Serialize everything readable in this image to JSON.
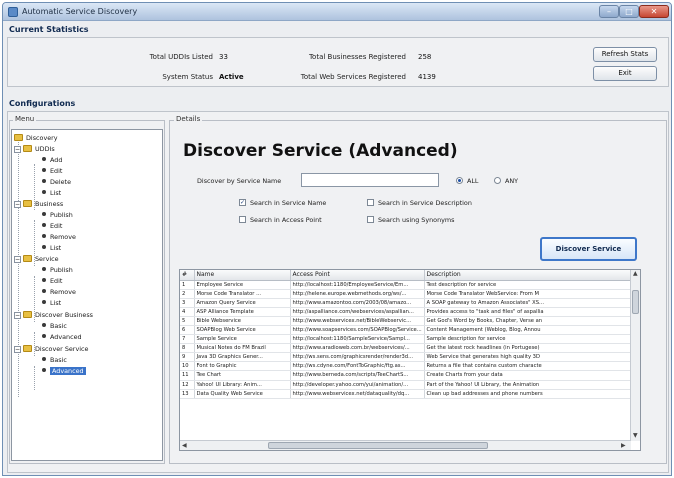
{
  "window": {
    "title": "Automatic Service Discovery",
    "min": "–",
    "max": "□",
    "close": "✕"
  },
  "stats": {
    "title": "Current Statistics",
    "total_uddis_label": "Total UDDIs Listed",
    "total_uddis_value": "33",
    "system_status_label": "System Status",
    "system_status_value": "Active",
    "businesses_label": "Total Businesses Registered",
    "businesses_value": "258",
    "web_services_label": "Total Web Services Registered",
    "web_services_value": "4139",
    "refresh_button": "Refresh Stats",
    "exit_button": "Exit"
  },
  "config": {
    "title": "Configurations",
    "menu_label": "Menu",
    "details_label": "Details"
  },
  "tree": {
    "root": "Discovery",
    "uddis": "UDDIs",
    "uddis_items": [
      "Add",
      "Edit",
      "Delete",
      "List"
    ],
    "business": "Business",
    "business_items": [
      "Publish",
      "Edit",
      "Remove",
      "List"
    ],
    "service": "Service",
    "service_items": [
      "Publish",
      "Edit",
      "Remove",
      "List"
    ],
    "discover_business": "Discover Business",
    "discover_business_items": [
      "Basic",
      "Advanced"
    ],
    "discover_service": "Discover Service",
    "discover_service_items": [
      "Basic",
      "Advanced"
    ]
  },
  "details": {
    "heading": "Discover Service (Advanced)",
    "search_label": "Discover by Service Name",
    "search_value": "",
    "radio_all": "ALL",
    "radio_any": "ANY",
    "radio_selected": "ALL",
    "check_service_name": "Search in Service Name",
    "check_service_description": "Search in Service Description",
    "check_access_point": "Search in Access Point",
    "check_synonyms": "Search using Synonyms",
    "discover_button": "Discover Service"
  },
  "table": {
    "headers": [
      "#",
      "Name",
      "Access Point",
      "Description"
    ],
    "rows": [
      [
        "1",
        "Employee Service",
        "http://localhost:1180/EmployeeService/Em...",
        "Test description for service"
      ],
      [
        "2",
        "Morse Code Translator ...",
        "http://helene.europe.webmethods.org/ws/...",
        "Morse Code Translator WebService: From M"
      ],
      [
        "3",
        "Amazon Query Service",
        "http://www.amazontoo.com/2003/08/amazo...",
        "A SOAP gateway to Amazon Associates\" XS..."
      ],
      [
        "4",
        "ASP Alliance Template",
        "http://aspalliance.com/webservices/aspallian...",
        "Provides access to \"task and files\" of aspallia"
      ],
      [
        "5",
        "Bible Webservice",
        "http://www.webservicex.net/BibleWebservic...",
        "Get God's Word by Books, Chapter, Verse an"
      ],
      [
        "6",
        "SOAPBlog Web Service",
        "http://www.soapservices.com/SOAPBlog/Service...",
        "Content Management (Weblog, Blog, Annou"
      ],
      [
        "7",
        "Sample Service",
        "http://localhost:1180/SampleService/Sampl...",
        "Sample description for service"
      ],
      [
        "8",
        "Musical Notes do FM Brazil",
        "http://www.aradioweb.com.br/webservices/...",
        "Get the latest rock headlines (in Portugese)"
      ],
      [
        "9",
        "Java 3D Graphics Gener...",
        "http://ws.sens.com/graphicsrender/render3d...",
        "Web Service that generates high quality 3D"
      ],
      [
        "10",
        "Font to Graphic",
        "http://ws.cdyne.com/FontToGraphic/ftg.as...",
        "Returns a file that contains custom characte"
      ],
      [
        "11",
        "Tee Chart",
        "http://www.berneda.com/scripts/TeeChartS...",
        "Create Charts from your data"
      ],
      [
        "12",
        "Yahoo! UI Library: Anim...",
        "http://developer.yahoo.com/yui/animation/...",
        "Part of the Yahoo! UI Library, the Animation"
      ],
      [
        "13",
        "Data Quality Web Service",
        "http://www.webservicex.net/dataquality/dq...",
        "Clean up bad addresses and phone numbers"
      ]
    ]
  }
}
